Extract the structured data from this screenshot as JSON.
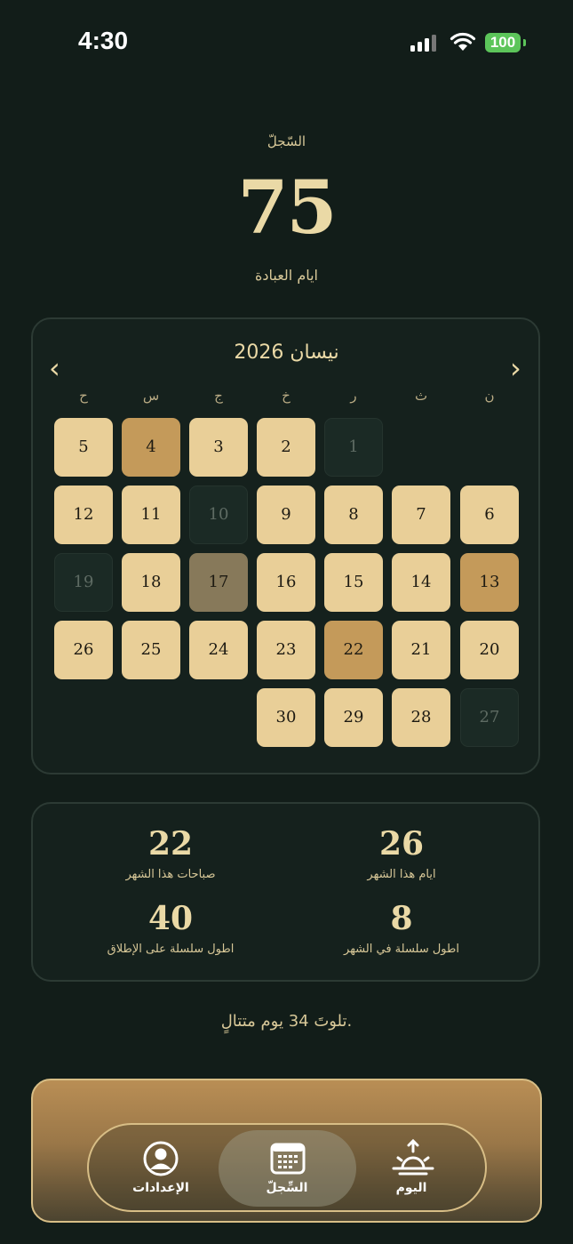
{
  "status_bar": {
    "time": "4:30",
    "battery": "100"
  },
  "header": {
    "label": "السّجلّ",
    "count": "75",
    "sub_label": "ايام العبادة"
  },
  "calendar": {
    "month_title": "نيسان 2026",
    "weekdays": [
      "ح",
      "س",
      "ج",
      "خ",
      "ر",
      "ث",
      "ن"
    ],
    "days": [
      {
        "n": "1",
        "state": "empty"
      },
      {
        "n": "2",
        "state": "full"
      },
      {
        "n": "3",
        "state": "full"
      },
      {
        "n": "4",
        "state": "dark"
      },
      {
        "n": "5",
        "state": "full"
      },
      {
        "n": "6",
        "state": "full"
      },
      {
        "n": "7",
        "state": "full"
      },
      {
        "n": "8",
        "state": "full"
      },
      {
        "n": "9",
        "state": "full"
      },
      {
        "n": "10",
        "state": "empty"
      },
      {
        "n": "11",
        "state": "full"
      },
      {
        "n": "12",
        "state": "full"
      },
      {
        "n": "13",
        "state": "dark"
      },
      {
        "n": "14",
        "state": "full"
      },
      {
        "n": "15",
        "state": "full"
      },
      {
        "n": "16",
        "state": "full"
      },
      {
        "n": "17",
        "state": "muted"
      },
      {
        "n": "18",
        "state": "full"
      },
      {
        "n": "19",
        "state": "empty"
      },
      {
        "n": "20",
        "state": "full"
      },
      {
        "n": "21",
        "state": "full"
      },
      {
        "n": "22",
        "state": "dark"
      },
      {
        "n": "23",
        "state": "full"
      },
      {
        "n": "24",
        "state": "full"
      },
      {
        "n": "25",
        "state": "full"
      },
      {
        "n": "26",
        "state": "full"
      },
      {
        "n": "27",
        "state": "empty"
      },
      {
        "n": "28",
        "state": "full"
      },
      {
        "n": "29",
        "state": "full"
      },
      {
        "n": "30",
        "state": "full"
      }
    ]
  },
  "stats": {
    "days_this_month": {
      "value": "26",
      "label": "ايام هذا الشهر"
    },
    "mornings_this_month": {
      "value": "22",
      "label": "صباحات هذا الشهر"
    },
    "longest_streak_month": {
      "value": "8",
      "label": "اطول سلسلة في الشهر"
    },
    "longest_streak_ever": {
      "value": "40",
      "label": "اطول سلسلة على الإطلاق"
    }
  },
  "streak_note": "تلوتَ 34 يوم متتالٍ.",
  "tabs": {
    "today": "اليوم",
    "log": "السِّجلّ",
    "settings": "الإعدادات"
  },
  "colors": {
    "full": "#e9cf98",
    "dark": "#c49a5a",
    "muted": "#87795a",
    "accent": "#ead9a6"
  }
}
